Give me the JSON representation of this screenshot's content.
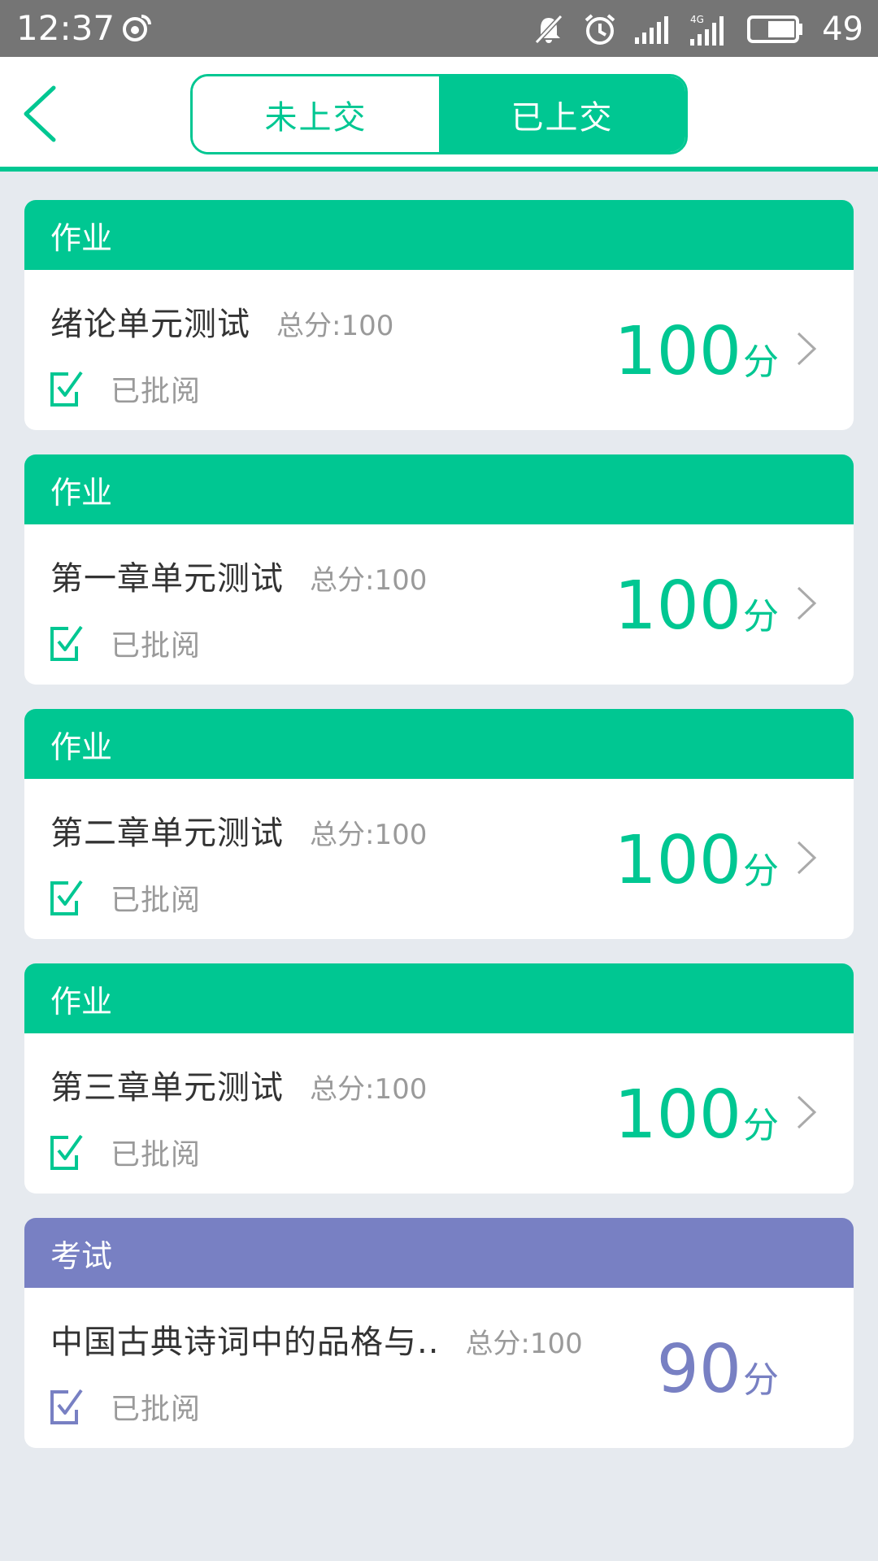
{
  "status_bar": {
    "time": "12:37",
    "battery_percent": "49",
    "icons": [
      "weibo-icon",
      "mute-icon",
      "alarm-icon",
      "signal-icon",
      "signal-4g-icon",
      "battery-icon"
    ]
  },
  "nav": {
    "back_icon": "chevron-left-icon",
    "tabs": [
      {
        "label": "未上交",
        "active": false
      },
      {
        "label": "已上交",
        "active": true
      }
    ]
  },
  "colors": {
    "accent": "#00c792",
    "exam": "#7880c3",
    "status_bar": "#757575",
    "background": "#e6eaef"
  },
  "items": [
    {
      "category": "作业",
      "title": "绪论单元测试",
      "total": "总分:100",
      "status": "已批阅",
      "score": "100",
      "unit": "分"
    },
    {
      "category": "作业",
      "title": "第一章单元测试",
      "total": "总分:100",
      "status": "已批阅",
      "score": "100",
      "unit": "分"
    },
    {
      "category": "作业",
      "title": "第二章单元测试",
      "total": "总分:100",
      "status": "已批阅",
      "score": "100",
      "unit": "分"
    },
    {
      "category": "作业",
      "title": "第三章单元测试",
      "total": "总分:100",
      "status": "已批阅",
      "score": "100",
      "unit": "分"
    },
    {
      "category": "考试",
      "title": "中国古典诗词中的品格与..",
      "total": "总分:100",
      "status": "已批阅",
      "score": "90",
      "unit": "分"
    }
  ]
}
